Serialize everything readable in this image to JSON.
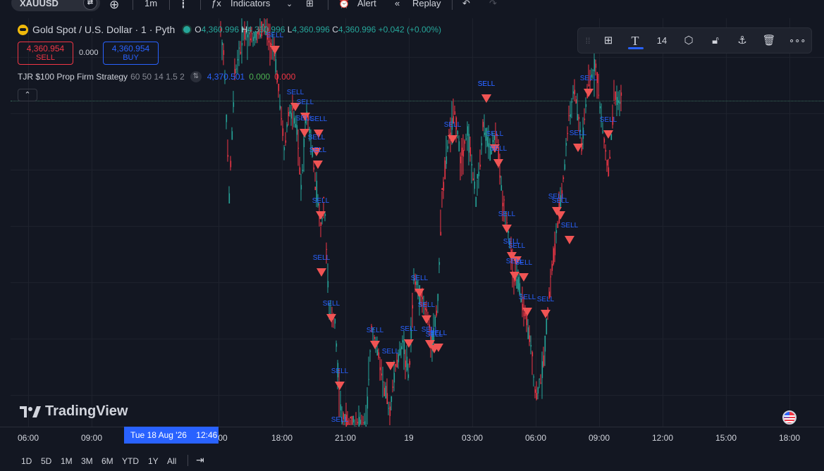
{
  "toolbar": {
    "symbol": "XAUUSD",
    "interval": "1m",
    "indicators_label": "Indicators",
    "alert_label": "Alert",
    "replay_label": "Replay"
  },
  "legend": {
    "title": "Gold Spot / U.S. Dollar · 1 · Pyth",
    "o_label": "O",
    "o_value": "4,360.996",
    "h_label": "H",
    "h_value": "4,360.996",
    "l_label": "L",
    "l_value": "4,360.996",
    "c_label": "C",
    "c_value": "4,360.996",
    "change": "+0.042 (+0.00%)"
  },
  "trade": {
    "sell_price": "4,360.954",
    "sell_label": "SELL",
    "spread": "0.000",
    "buy_price": "4,360.954",
    "buy_label": "BUY"
  },
  "strategy": {
    "name": "TJR $100 Prop Firm Strategy",
    "params": "60 50 14 1.5 2",
    "value1": "4,370.501",
    "value2": "0.000",
    "value3": "0.000"
  },
  "drawing_toolbar": {
    "font_size": "14"
  },
  "brand": "TradingView",
  "signal_label": "SELL",
  "time_axis": {
    "labels": [
      "06:00",
      "09:00",
      "00",
      "18:00",
      "21:00",
      "19",
      "03:00",
      "06:00",
      "09:00",
      "12:00",
      "15:00",
      "18:00"
    ],
    "cursor_date": "Tue 18 Aug '26",
    "cursor_time": "12:46"
  },
  "ranges": [
    "1D",
    "5D",
    "1M",
    "3M",
    "6M",
    "YTD",
    "1Y",
    "All"
  ],
  "colors": {
    "bull": "#26a69a",
    "bear": "#f23645",
    "signal": "#f05454",
    "accent": "#2962ff"
  },
  "chart_data": {
    "type": "candlestick",
    "symbol": "XAUUSD",
    "sell_signals": 38
  }
}
